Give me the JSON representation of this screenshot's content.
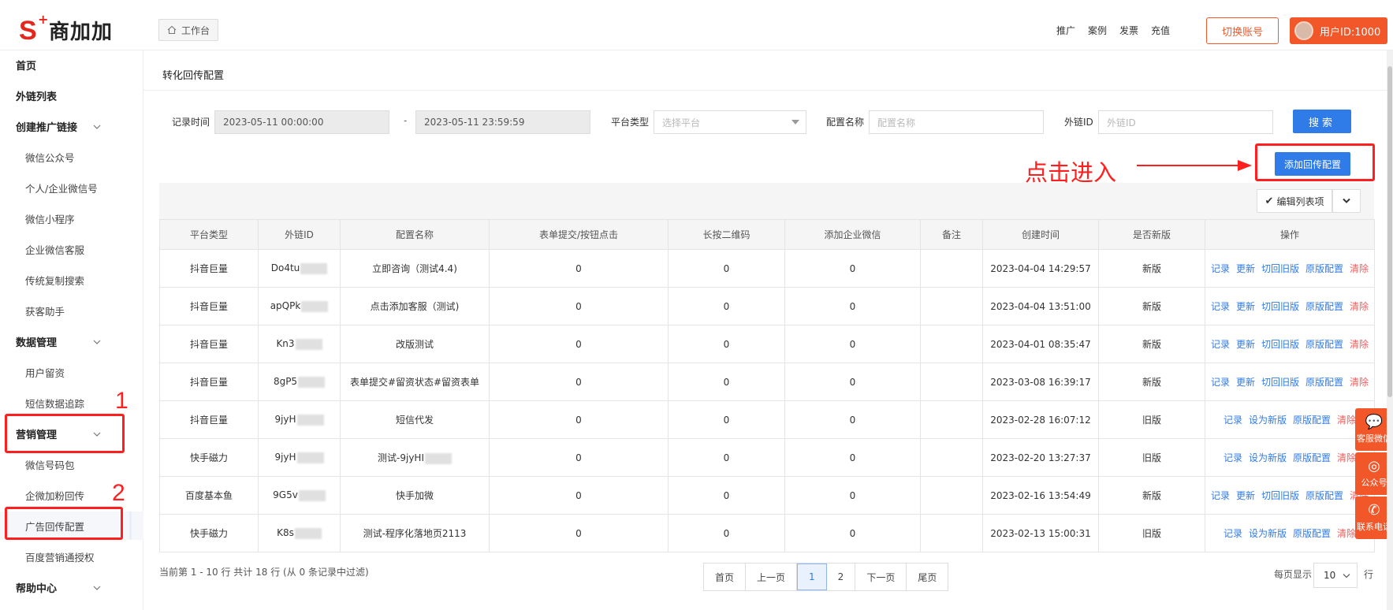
{
  "header": {
    "logo_text": "商加加",
    "workbench_label": "工作台",
    "links": [
      "推广",
      "案例",
      "发票",
      "充值"
    ],
    "switch_account": "切换账号",
    "user_id": "用户ID:1000"
  },
  "sidebar": {
    "items": [
      {
        "label": "首页",
        "level": "top"
      },
      {
        "label": "外链列表",
        "level": "top"
      },
      {
        "label": "创建推广链接",
        "level": "top",
        "expandable": true
      },
      {
        "label": "微信公众号",
        "level": "sub"
      },
      {
        "label": "个人/企业微信号",
        "level": "sub"
      },
      {
        "label": "微信小程序",
        "level": "sub"
      },
      {
        "label": "企业微信客服",
        "level": "sub"
      },
      {
        "label": "传统复制搜索",
        "level": "sub"
      },
      {
        "label": "获客助手",
        "level": "sub"
      },
      {
        "label": "数据管理",
        "level": "top",
        "expandable": true
      },
      {
        "label": "用户留资",
        "level": "sub"
      },
      {
        "label": "短信数据追踪",
        "level": "sub"
      },
      {
        "label": "营销管理",
        "level": "top",
        "expandable": true
      },
      {
        "label": "微信号码包",
        "level": "sub"
      },
      {
        "label": "企微加粉回传",
        "level": "sub"
      },
      {
        "label": "广告回传配置",
        "level": "sub",
        "active": true
      },
      {
        "label": "百度营销通授权",
        "level": "sub"
      },
      {
        "label": "帮助中心",
        "level": "top",
        "expandable": true
      }
    ]
  },
  "annotations": {
    "num1": "1",
    "num2": "2",
    "hint": "点击进入"
  },
  "page": {
    "title": "转化回传配置"
  },
  "filters": {
    "record_time_label": "记录时间",
    "start_time": "2023-05-11 00:00:00",
    "dash": "-",
    "end_time": "2023-05-11 23:59:59",
    "platform_label": "平台类型",
    "platform_placeholder": "选择平台",
    "config_name_label": "配置名称",
    "config_name_placeholder": "配置名称",
    "link_id_label": "外链ID",
    "link_id_placeholder": "外链ID",
    "search_button": "搜索"
  },
  "actions": {
    "add_config": "添加回传配置",
    "edit_columns": "编辑列表项"
  },
  "table": {
    "headers": [
      "平台类型",
      "外链ID",
      "配置名称",
      "表单提交/按钮点击",
      "长按二维码",
      "添加企业微信",
      "备注",
      "创建时间",
      "是否新版",
      "操作"
    ],
    "rows": [
      {
        "platform": "抖音巨量",
        "link_id": "Do4tu",
        "name": "立即咨询（测试4.4)",
        "form": "0",
        "qr": "0",
        "wx": "0",
        "remark": "",
        "created": "2023-04-04 14:29:57",
        "version": "新版",
        "ops": [
          "记录",
          "更新",
          "切回旧版",
          "原版配置",
          "清除"
        ]
      },
      {
        "platform": "抖音巨量",
        "link_id": "apQPk",
        "name": "点击添加客服（测试)",
        "form": "0",
        "qr": "0",
        "wx": "0",
        "remark": "",
        "created": "2023-04-04 13:51:00",
        "version": "新版",
        "ops": [
          "记录",
          "更新",
          "切回旧版",
          "原版配置",
          "清除"
        ]
      },
      {
        "platform": "抖音巨量",
        "link_id": "Kn3",
        "name": "改版测试",
        "form": "0",
        "qr": "0",
        "wx": "0",
        "remark": "",
        "created": "2023-04-01 08:35:47",
        "version": "新版",
        "ops": [
          "记录",
          "更新",
          "切回旧版",
          "原版配置",
          "清除"
        ]
      },
      {
        "platform": "抖音巨量",
        "link_id": "8gP5",
        "name": "表单提交#留资状态#留资表单",
        "form": "0",
        "qr": "0",
        "wx": "0",
        "remark": "",
        "created": "2023-03-08 16:39:17",
        "version": "新版",
        "ops": [
          "记录",
          "更新",
          "切回旧版",
          "原版配置",
          "清除"
        ]
      },
      {
        "platform": "抖音巨量",
        "link_id": "9jyH",
        "name": "短信代发",
        "form": "0",
        "qr": "0",
        "wx": "0",
        "remark": "",
        "created": "2023-02-28 16:07:12",
        "version": "旧版",
        "ops": [
          "记录",
          "设为新版",
          "原版配置",
          "清除"
        ]
      },
      {
        "platform": "快手磁力",
        "link_id": "9jyH",
        "name": "测试-9jyHI",
        "form": "0",
        "qr": "0",
        "wx": "0",
        "remark": "",
        "created": "2023-02-20 13:27:37",
        "version": "旧版",
        "ops": [
          "记录",
          "设为新版",
          "原版配置",
          "清除"
        ]
      },
      {
        "platform": "百度基本鱼",
        "link_id": "9G5v",
        "name": "快手加微",
        "form": "0",
        "qr": "0",
        "wx": "0",
        "remark": "",
        "created": "2023-02-16 13:54:49",
        "version": "新版",
        "ops": [
          "记录",
          "更新",
          "切回旧版",
          "原版配置",
          "清除"
        ]
      },
      {
        "platform": "快手磁力",
        "link_id": "K8s",
        "name": "测试-程序化落地页2113",
        "form": "0",
        "qr": "0",
        "wx": "0",
        "remark": "",
        "created": "2023-02-13 15:00:31",
        "version": "旧版",
        "ops": [
          "记录",
          "设为新版",
          "原版配置",
          "清除"
        ]
      }
    ]
  },
  "pagination": {
    "info": "当前第 1 - 10 行   共计 18 行 (从 0 条记录中过滤)",
    "first": "首页",
    "prev": "上一页",
    "pages": [
      "1",
      "2"
    ],
    "current": "1",
    "next": "下一页",
    "last": "尾页",
    "per_page_label": "每页显示",
    "per_page_value": "10",
    "per_page_suffix": "行"
  },
  "float_bar": {
    "wechat": "客服微信",
    "official": "公众号",
    "contact": "联系电话"
  },
  "colors": {
    "brand_orange": "#f2572a",
    "primary_blue": "#2f7be8",
    "annotation_red": "#ff1f1f",
    "danger": "#f05a5a"
  }
}
